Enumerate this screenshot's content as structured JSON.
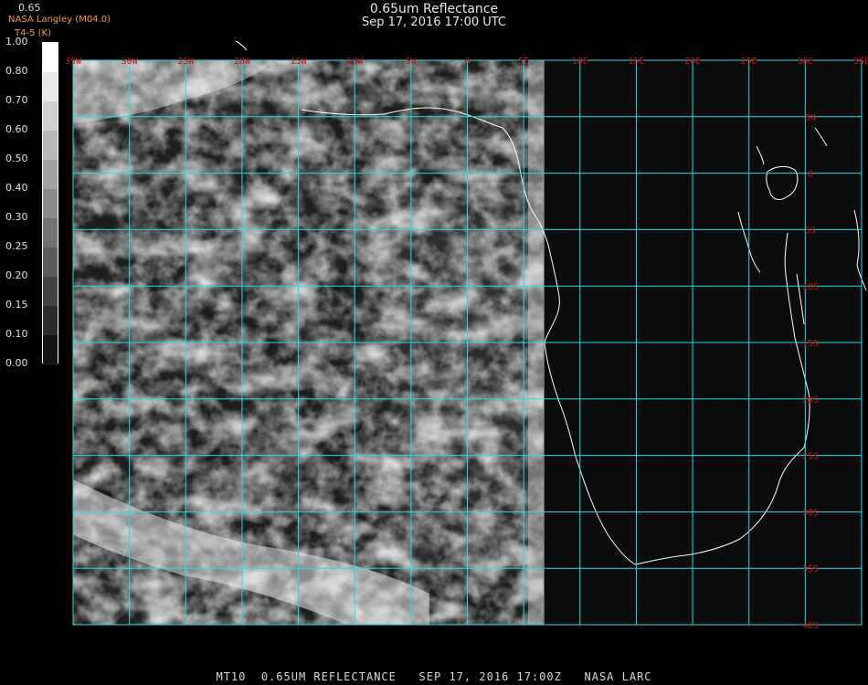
{
  "header": {
    "title": "0.65um Reflectance",
    "subtitle": "Sep 17, 2016 17:00 UTC",
    "value_label": "0.65",
    "credit": "NASA Langley (M04.0)",
    "band": "T4-5 (K)"
  },
  "colorbar": {
    "ticks": [
      "1.00",
      "0.80",
      "0.70",
      "0.60",
      "0.50",
      "0.40",
      "0.30",
      "0.25",
      "0.20",
      "0.15",
      "0.10",
      "0.00"
    ]
  },
  "map": {
    "lon_range": [
      -35,
      35
    ],
    "lat_range": [
      -40,
      10
    ],
    "lon_labels": [
      "35W",
      "30W",
      "25W",
      "20W",
      "15W",
      "10W",
      "5W",
      "0",
      "5E",
      "10E",
      "15E",
      "20E",
      "25E",
      "30E",
      "35E"
    ],
    "lat_labels": [
      "5N",
      "0",
      "5S",
      "10S",
      "15S",
      "20S",
      "25S",
      "30S",
      "35S",
      "40S"
    ],
    "grid_color": "#20e0e0",
    "label_color": "#d01010",
    "coast_color": "#ffffff"
  },
  "footer": {
    "text": "MT10  0.65UM REFLECTANCE   SEP 17, 2016 17:00Z   NASA LARC"
  }
}
